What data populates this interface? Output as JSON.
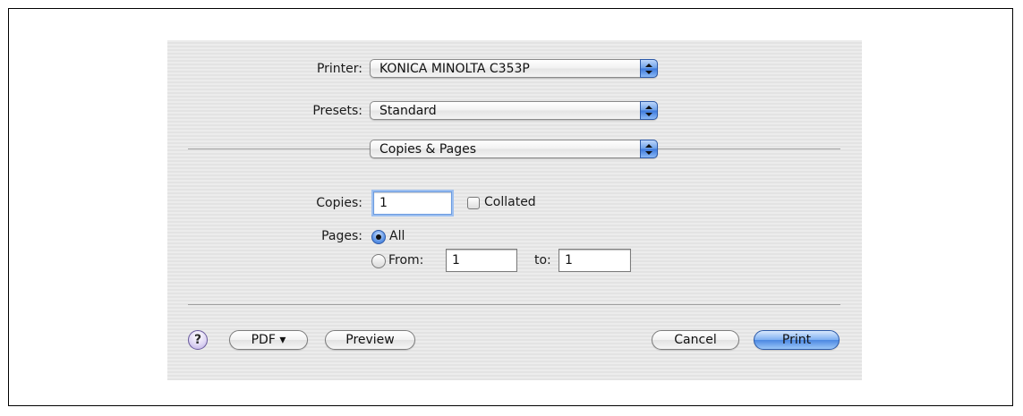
{
  "printer": {
    "label": "Printer:",
    "value": "KONICA MINOLTA C353P"
  },
  "presets": {
    "label": "Presets:",
    "value": "Standard"
  },
  "panel": {
    "value": "Copies & Pages"
  },
  "copies": {
    "label": "Copies:",
    "value": "1",
    "collated_label": "Collated",
    "collated_checked": false
  },
  "pages": {
    "label": "Pages:",
    "all_label": "All",
    "from_label": "From:",
    "from_value": "1",
    "to_label": "to:",
    "to_value": "1",
    "selected": "All"
  },
  "buttons": {
    "help": "?",
    "pdf": "PDF ▾",
    "preview": "Preview",
    "cancel": "Cancel",
    "print": "Print"
  },
  "colors": {
    "accent": "#3b78dc",
    "dialog_bg": "#e9e9e9"
  }
}
